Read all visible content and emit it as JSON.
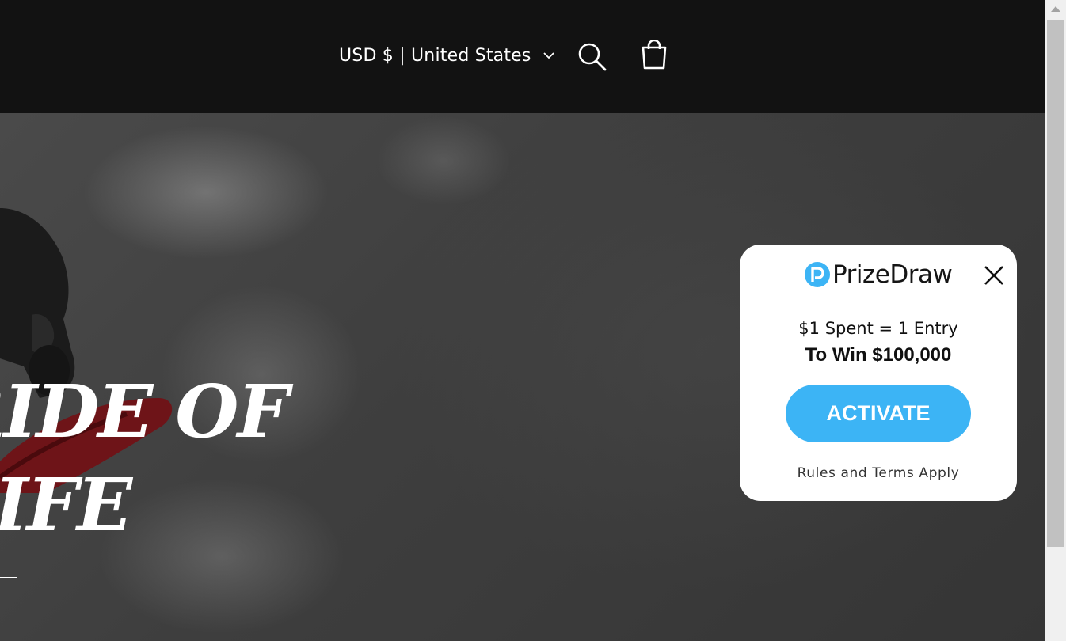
{
  "header": {
    "currency_selector": "USD $ | United States"
  },
  "hero": {
    "title": "RIDE OF\nLIFE"
  },
  "popup": {
    "brand": "PrizeDraw",
    "line1": "$1 Spent = 1 Entry",
    "line2": "To Win $100,000",
    "button_label": "ACTIVATE",
    "terms": "Rules and Terms Apply",
    "accent_color": "#3cb4f5"
  },
  "icons": {
    "chevron": "chevron-down-icon",
    "search": "search-icon",
    "cart": "cart-icon",
    "close": "close-icon",
    "logo": "prizedraw-logo-icon"
  }
}
